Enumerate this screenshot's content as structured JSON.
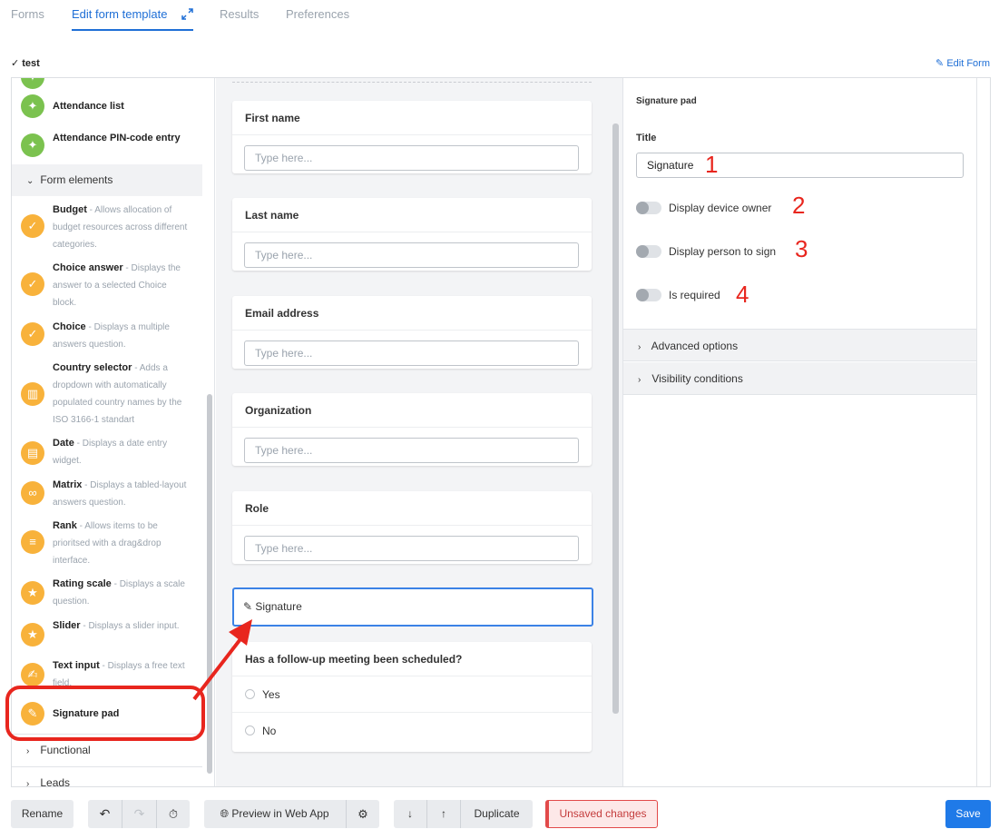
{
  "tabs": [
    {
      "label": "Forms"
    },
    {
      "label": "Edit form template"
    },
    {
      "label": "Results"
    },
    {
      "label": "Preferences"
    }
  ],
  "form_name": "✓ test",
  "edit_form_label": "Edit Form",
  "sidebar": {
    "items_top": [
      {
        "title": "Attendance list",
        "desc": ""
      },
      {
        "title": "Attendance PIN-code entry",
        "desc": ""
      }
    ],
    "section_form_elements": "Form elements",
    "elements": [
      {
        "title": "Budget",
        "desc": " - Allows allocation of budget resources across different categories.",
        "icon": "check-icon"
      },
      {
        "title": "Choice answer",
        "desc": " - Displays the answer to a selected Choice block.",
        "icon": "check-icon"
      },
      {
        "title": "Choice",
        "desc": " - Displays a multiple answers question.",
        "icon": "check-icon"
      },
      {
        "title": "Country selector",
        "desc": " - Adds a dropdown with automatically populated country names by the ISO 3166-1 standart",
        "icon": "map-icon"
      },
      {
        "title": "Date",
        "desc": " - Displays a date entry widget.",
        "icon": "calendar-icon"
      },
      {
        "title": "Matrix",
        "desc": " - Displays a tabled-layout answers question.",
        "icon": "infinity-icon"
      },
      {
        "title": "Rank",
        "desc": " - Allows items to be prioritsed with a drag&drop interface.",
        "icon": "list-icon"
      },
      {
        "title": "Rating scale",
        "desc": " - Displays a scale question.",
        "icon": "star-icon"
      },
      {
        "title": "Slider",
        "desc": " - Displays a slider input.",
        "icon": "star-icon"
      },
      {
        "title": "Text input",
        "desc": " - Displays a free text field.",
        "icon": "text-icon"
      },
      {
        "title": "Signature pad",
        "desc": "",
        "icon": "pen-icon"
      }
    ],
    "section_functional": "Functional",
    "section_leads": "Leads"
  },
  "center": {
    "cards": [
      {
        "title": "First name",
        "placeholder": "Type here..."
      },
      {
        "title": "Last name",
        "placeholder": "Type here..."
      },
      {
        "title": "Email address",
        "placeholder": "Type here..."
      },
      {
        "title": "Organization",
        "placeholder": "Type here..."
      },
      {
        "title": "Role",
        "placeholder": "Type here..."
      }
    ],
    "signature_label": "Signature",
    "question": {
      "title": "Has a follow-up meeting been scheduled?",
      "options": [
        "Yes",
        "No"
      ]
    }
  },
  "right_panel": {
    "heading": "Signature pad",
    "title_label": "Title",
    "title_value": "Signature",
    "toggles": [
      {
        "label": "Display device owner",
        "annotation": "2"
      },
      {
        "label": "Display person to sign",
        "annotation": "3"
      },
      {
        "label": "Is required",
        "annotation": "4"
      }
    ],
    "title_annotation": "1",
    "sections": [
      "Advanced options",
      "Visibility conditions"
    ]
  },
  "toolbar": {
    "rename": "Rename",
    "preview": "Preview in Web App",
    "duplicate": "Duplicate",
    "unsaved": "Unsaved changes",
    "save": "Save"
  },
  "colors": {
    "accent": "#1f6fd6",
    "annotation_red": "#e8261e",
    "green_icon": "#7bc24f",
    "orange_icon": "#f8b23b"
  }
}
